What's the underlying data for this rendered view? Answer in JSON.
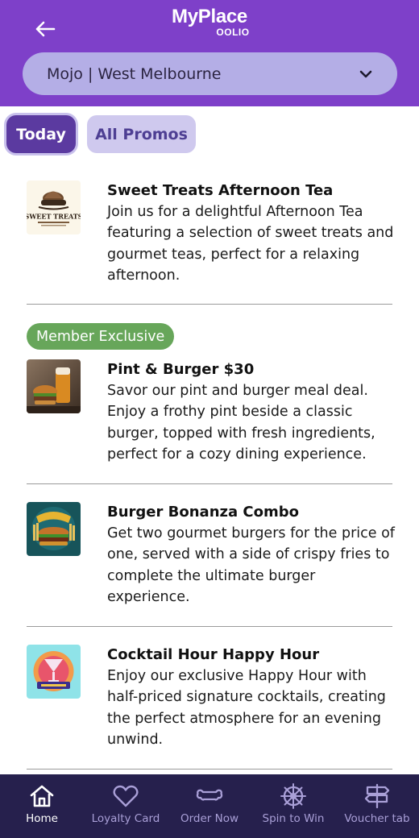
{
  "header": {
    "logo_main": "MyPlace",
    "logo_sub": "OOLIO",
    "venue_selected": "Mojo | West Melbourne"
  },
  "tabs": [
    {
      "label": "Today",
      "active": true
    },
    {
      "label": "All Promos",
      "active": false
    }
  ],
  "promos": [
    {
      "title": "Sweet Treats Afternoon Tea",
      "description": "Join us for a delightful Afternoon Tea featuring a selection of sweet treats and gourmet teas, perfect for a relaxing afternoon.",
      "image_icon": "sweet-treats-logo",
      "badge": null
    },
    {
      "title": "Pint & Burger $30",
      "description": "Savor our pint and burger meal deal. Enjoy a frothy pint beside a classic burger, topped with fresh ingredients, perfect for a cozy dining experience.",
      "image_icon": "pint-burger-photo",
      "badge": "Member Exclusive"
    },
    {
      "title": "Burger Bonanza Combo",
      "description": "Get two gourmet burgers for the price of one, served with a side of crispy fries to complete the ultimate burger experience.",
      "image_icon": "burger-bonanza-logo"
    },
    {
      "title": "Cocktail Hour Happy Hour",
      "description": "Enjoy our exclusive Happy Hour with half-priced signature cocktails, creating the perfect atmosphere for an evening unwind.",
      "image_icon": "cocktail-hour-logo"
    }
  ],
  "bottom_nav": [
    {
      "label": "Home",
      "icon": "home-icon",
      "active": true
    },
    {
      "label": "Loyalty Card",
      "icon": "heart-icon",
      "active": false
    },
    {
      "label": "Order Now",
      "icon": "bone-icon",
      "active": false
    },
    {
      "label": "Spin to Win",
      "icon": "wheel-icon",
      "active": false
    },
    {
      "label": "Voucher tab",
      "icon": "signpost-icon",
      "active": false
    }
  ],
  "colors": {
    "header_bg": "#7e40c9",
    "select_bg": "#b4aee6",
    "tab_active_bg": "#5b3aa0",
    "tab_inactive_bg": "#cfc9ee",
    "badge_bg": "#67a65a",
    "nav_bg": "#26204d",
    "nav_label": "#a99fd7"
  }
}
